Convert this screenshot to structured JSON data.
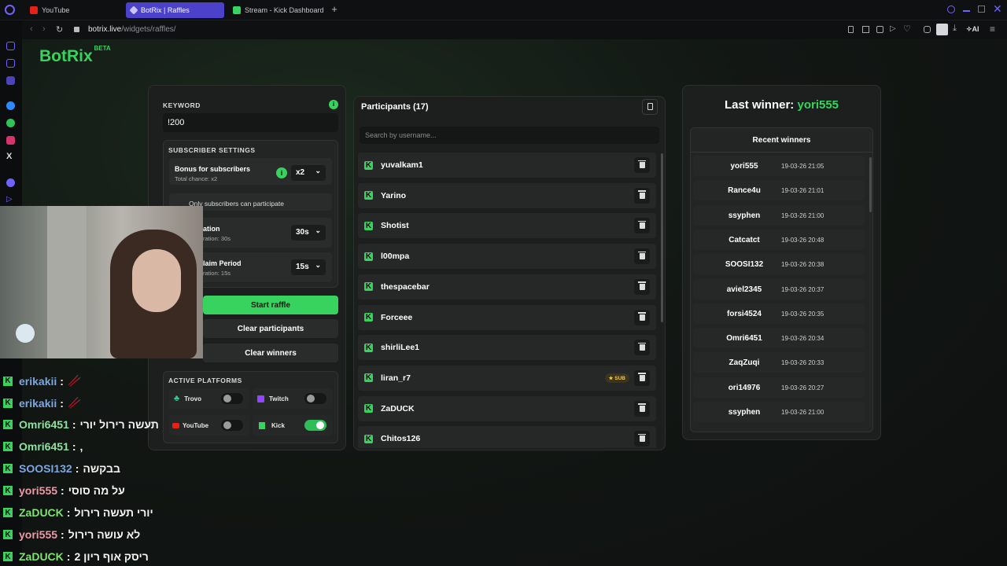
{
  "browser": {
    "tabs": [
      {
        "label": "YouTube",
        "active": false,
        "icon": "youtube-icon",
        "color": "#e62117"
      },
      {
        "label": "BotRix | Raffles",
        "active": true,
        "icon": "botrix-icon",
        "color": "#8e7bff"
      },
      {
        "label": "Stream - Kick Dashboard",
        "active": false,
        "icon": "kick-icon",
        "color": "#38d35e"
      }
    ],
    "url_host": "botrix.live",
    "url_path": "/widgets/raffles/",
    "ai_label": "AI"
  },
  "brand": {
    "logo": "BotRix",
    "beta": "BETA",
    "color": "#38d35e"
  },
  "settings": {
    "keyword_label": "KEYWORD",
    "keyword_value": "!200",
    "subscriber_settings_label": "SUBSCRIBER SETTINGS",
    "bonus_title": "Bonus for subscribers",
    "bonus_sub": "Total chance: x2",
    "bonus_value": "x2",
    "only_subs_label": "Only subscribers can participate",
    "duration_title": "ation",
    "duration_sub": "ration: 30s",
    "duration_value": "30s",
    "claim_title": "laim Period",
    "claim_sub": "ration: 15s",
    "claim_value": "15s",
    "start_label": "Start raffle",
    "clear_participants_label": "Clear participants",
    "clear_winners_label": "Clear winners",
    "active_platforms_label": "ACTIVE PLATFORMS",
    "platforms": [
      {
        "name": "Trovo",
        "on": false
      },
      {
        "name": "Twitch",
        "on": false
      },
      {
        "name": "YouTube",
        "on": false
      },
      {
        "name": "Kick",
        "on": true
      }
    ]
  },
  "participants": {
    "title": "Participants (17)",
    "search_placeholder": "Search by username...",
    "sub_badge": "SUB",
    "items": [
      "yuvalkam1",
      "Yarino",
      "Shotist",
      "l00mpa",
      "thespacebar",
      "Forceee",
      "shirliLee1",
      "liran_r7",
      "ZaDUCK",
      "Chitos126"
    ]
  },
  "winners": {
    "last_label": "Last winner:",
    "last_name": "yori555",
    "recent_label": "Recent winners",
    "items": [
      {
        "name": "yori555",
        "date": "19-03-26 21:05"
      },
      {
        "name": "Rance4u",
        "date": "19-03-26 21:01"
      },
      {
        "name": "ssyphen",
        "date": "19-03-26 21:00"
      },
      {
        "name": "Catcatct",
        "date": "19-03-26 20:48"
      },
      {
        "name": "SOOSI132",
        "date": "19-03-26 20:38"
      },
      {
        "name": "aviel2345",
        "date": "19-03-26 20:37"
      },
      {
        "name": "forsi4524",
        "date": "19-03-26 20:35"
      },
      {
        "name": "Omri6451",
        "date": "19-03-26 20:34"
      },
      {
        "name": "ZaqZuqi",
        "date": "19-03-26 20:33"
      },
      {
        "name": "ori14976",
        "date": "19-03-26 20:27"
      },
      {
        "name": "ssyphen",
        "date": "19-03-26 21:00"
      }
    ]
  },
  "chat": [
    {
      "user": "erikakii",
      "msg": "🥢",
      "color": "#7ea6e0"
    },
    {
      "user": "erikakii",
      "msg": "🥢",
      "color": "#7ea6e0"
    },
    {
      "user": "Omri6451",
      "msg": "תעשה רירול יורי",
      "color": "#8fe0a0"
    },
    {
      "user": "Omri6451",
      "msg": ",",
      "color": "#8fe0a0"
    },
    {
      "user": "SOOSI132",
      "msg": "בבקשה",
      "color": "#7ea6e0"
    },
    {
      "user": "yori555",
      "msg": "על מה סוסי",
      "color": "#ec9aa6"
    },
    {
      "user": "ZaDUCK",
      "msg": "יורי תעשה רירול",
      "color": "#7ee36e"
    },
    {
      "user": "yori555",
      "msg": "לא עושה רירול",
      "color": "#ec9aa6"
    },
    {
      "user": "ZaDUCK",
      "msg": "ריסק אוף ריון 2",
      "color": "#7ee36e"
    }
  ]
}
